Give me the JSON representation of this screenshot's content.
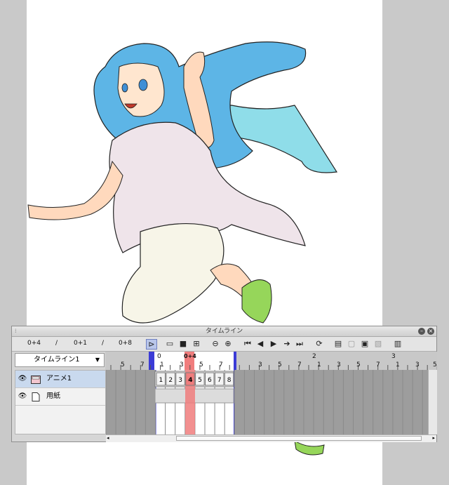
{
  "panel": {
    "title": "タイムライン",
    "toolbar": {
      "frame_a": "0+4",
      "sep_a": "/",
      "frame_b": "0+1",
      "sep_b": "/",
      "frame_c": "0+8"
    },
    "timeline_select": "タイムライン1",
    "ruler": {
      "current_label": "0+4",
      "second_marks": [
        "0",
        "2",
        "3"
      ],
      "frame_ticks": [
        "5",
        "7",
        "1",
        "3",
        "5",
        "7",
        "3",
        "5",
        "7",
        "1",
        "3",
        "5",
        "7",
        "1",
        "3",
        "5"
      ]
    },
    "layers": [
      {
        "name": "アニメ1",
        "icon": "animation-folder-icon",
        "selected": true
      },
      {
        "name": "用紙",
        "icon": "paper-icon",
        "selected": false
      }
    ],
    "cels": [
      "1",
      "2",
      "3",
      "4",
      "5",
      "6",
      "7",
      "8"
    ],
    "current_cel": "4",
    "colors": {
      "playhead": "#f07d7d",
      "range_marker": "#3b3bd6",
      "selection": "#c9d9ee",
      "grid": "#9d9d9d",
      "work_area": "#ffffff"
    }
  }
}
